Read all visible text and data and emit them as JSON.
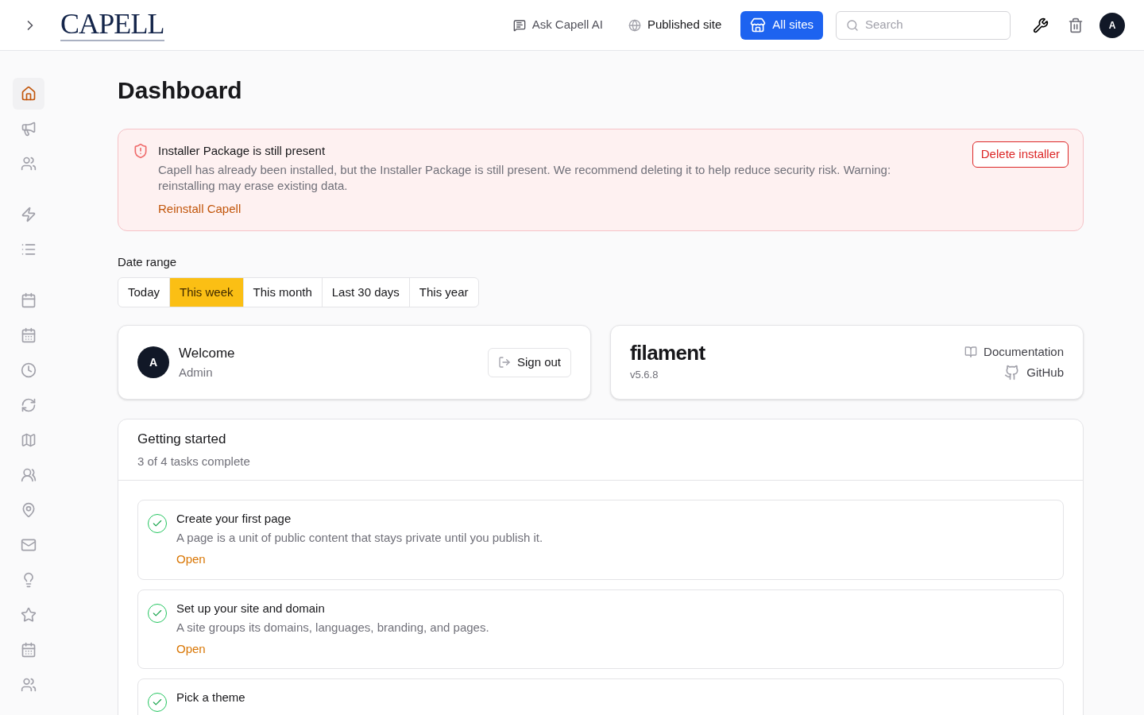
{
  "header": {
    "logo": "CAPELL",
    "links": [
      {
        "kind": "ai",
        "label": "Ask Capell AI"
      },
      {
        "kind": "site",
        "label": "Published site"
      }
    ],
    "sites_button": "All sites",
    "search": {
      "placeholder": "Search"
    },
    "avatar": "A"
  },
  "sidebar": {
    "groups": [
      [
        {
          "selected": true
        },
        {
          "selected": false
        },
        {
          "selected": false
        }
      ],
      [
        {
          "selected": false
        },
        {
          "selected": false
        }
      ],
      [
        {
          "selected": false
        },
        {
          "selected": false
        },
        {
          "selected": false
        },
        {
          "selected": false
        },
        {
          "selected": false
        },
        {
          "selected": false
        },
        {
          "selected": false
        },
        {
          "selected": false
        },
        {
          "selected": false
        },
        {
          "selected": false
        },
        {
          "selected": false
        },
        {
          "selected": false
        }
      ]
    ]
  },
  "page_title": "Dashboard",
  "alert": {
    "title": "Installer Package is still present",
    "message": "Capell has already been installed, but the Installer Package is still present. We recommend deleting it to help reduce security risk. Warning: reinstalling may erase existing data.",
    "link": "Reinstall Capell",
    "button": "Delete installer"
  },
  "date_range": {
    "label": "Date range",
    "options": [
      {
        "label": "Today",
        "selected": false
      },
      {
        "label": "This week",
        "selected": true
      },
      {
        "label": "This month",
        "selected": false
      },
      {
        "label": "Last 30 days",
        "selected": false
      },
      {
        "label": "This year",
        "selected": false
      }
    ]
  },
  "welcome": {
    "avatar": "A",
    "title": "Welcome",
    "subtitle": "Admin",
    "button": "Sign out"
  },
  "filament": {
    "logo": "filament",
    "version": "v5.6.8",
    "links": [
      "Documentation",
      "GitHub"
    ]
  },
  "getting_started": {
    "title": "Getting started",
    "subtitle": "3 of 4 tasks complete",
    "tasks": [
      {
        "title": "Create your first page",
        "description": "A page is a unit of public content that stays private until you publish it.",
        "action": "Open",
        "done": true
      },
      {
        "title": "Set up your site and domain",
        "description": "A site groups its domains, languages, branding, and pages.",
        "action": "Open",
        "done": true
      },
      {
        "title": "Pick a theme",
        "done": true
      }
    ]
  }
}
